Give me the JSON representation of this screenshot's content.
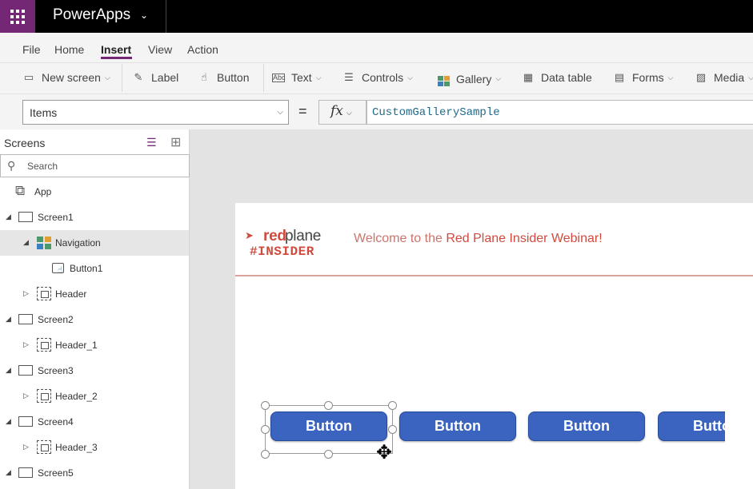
{
  "app": {
    "title": "PowerApps"
  },
  "menu": {
    "items": [
      "File",
      "Home",
      "Insert",
      "View",
      "Action"
    ],
    "active": "Insert",
    "accent": "#742774"
  },
  "ribbon": {
    "new_screen": "New screen",
    "label": "Label",
    "button": "Button",
    "text": "Text",
    "controls": "Controls",
    "gallery": "Gallery",
    "data_table": "Data table",
    "forms": "Forms",
    "media": "Media"
  },
  "formula": {
    "property": "Items",
    "equals": "=",
    "fx": "fx",
    "value": "CustomGallerySample"
  },
  "panel": {
    "title": "Screens",
    "search_placeholder": "Search",
    "tree": [
      {
        "label": "App",
        "icon": "app-icon"
      },
      {
        "label": "Screen1",
        "icon": "screen-icon",
        "expanded": true
      },
      {
        "label": "Navigation",
        "icon": "gallery-icon",
        "expanded": true,
        "selected": true
      },
      {
        "label": "Button1",
        "icon": "button-icon"
      },
      {
        "label": "Header",
        "icon": "group-icon",
        "expanded": false
      },
      {
        "label": "Screen2",
        "icon": "screen-icon",
        "expanded": true
      },
      {
        "label": "Header_1",
        "icon": "group-icon",
        "expanded": false
      },
      {
        "label": "Screen3",
        "icon": "screen-icon",
        "expanded": true
      },
      {
        "label": "Header_2",
        "icon": "group-icon",
        "expanded": false
      },
      {
        "label": "Screen4",
        "icon": "screen-icon",
        "expanded": true
      },
      {
        "label": "Header_3",
        "icon": "group-icon",
        "expanded": false
      },
      {
        "label": "Screen5",
        "icon": "screen-icon",
        "expanded": true
      }
    ]
  },
  "canvas": {
    "brand_red": "red",
    "brand_plane": "plane",
    "brand_tag": "#INSIDER",
    "welcome_prefix": "Welcome to the ",
    "welcome_emph": "Red Plane Insider Webinar!",
    "buttons": [
      "Button",
      "Button",
      "Button",
      "Button"
    ],
    "brand_color": "#d04a3e",
    "button_color": "#3a64c0"
  }
}
